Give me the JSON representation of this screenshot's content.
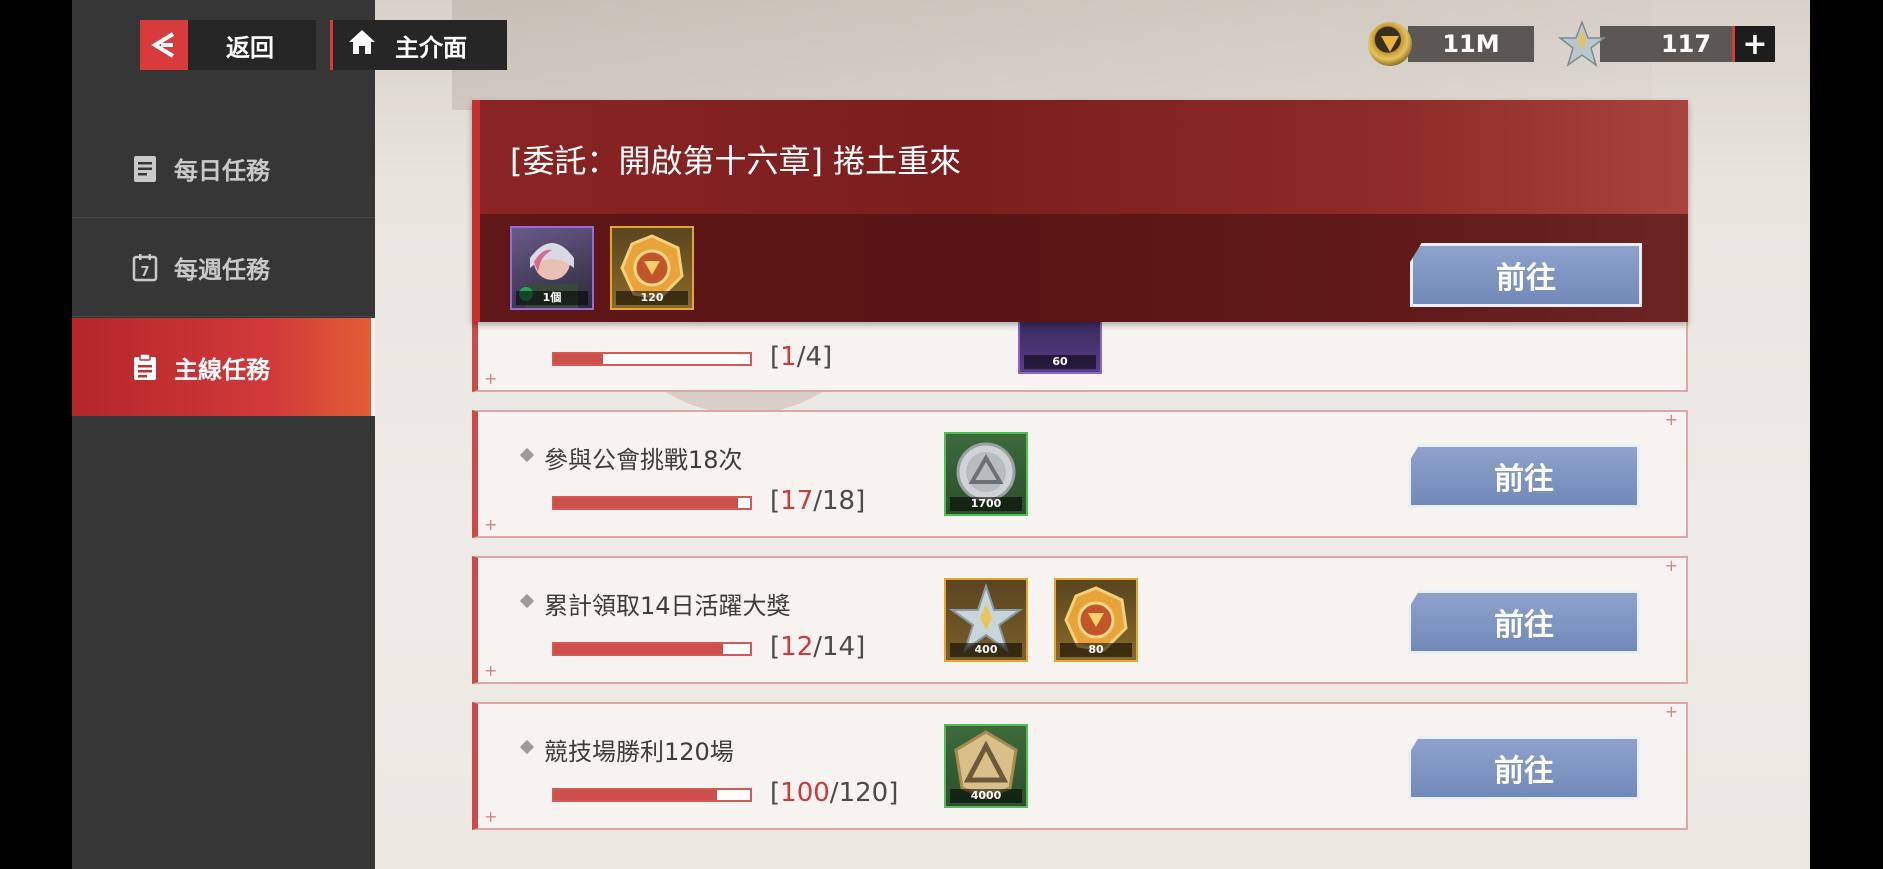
{
  "nav": {
    "back_label": "返回",
    "home_label": "主介面"
  },
  "currency": {
    "gold": "11M",
    "stars": "117",
    "plus": "+"
  },
  "sidebar": {
    "items": [
      {
        "label": "每日任務",
        "icon": "document-icon",
        "active": false
      },
      {
        "label": "每週任務",
        "icon": "calendar-icon",
        "active": false
      },
      {
        "label": "主線任務",
        "icon": "clipboard-icon",
        "active": true
      }
    ]
  },
  "featured": {
    "title": "[委託：開啟第十六章] 捲土重來",
    "rewards": [
      {
        "icon": "character-portrait-icon",
        "count": "1個"
      },
      {
        "icon": "gold-medal-icon",
        "count": "120"
      }
    ],
    "button": "前往"
  },
  "partial_row": {
    "progress_current": "1",
    "progress_total": "4",
    "reward_count": "60"
  },
  "missions": [
    {
      "name": "參與公會挑戰18次",
      "current": "17",
      "total": "18",
      "ratio": 0.944,
      "rewards": [
        {
          "icon": "silver-coin-icon",
          "count": "1700"
        }
      ],
      "button": "前往"
    },
    {
      "name": "累計領取14日活躍大獎",
      "current": "12",
      "total": "14",
      "ratio": 0.857,
      "rewards": [
        {
          "icon": "crystal-star-icon",
          "count": "400"
        },
        {
          "icon": "gold-medal-icon",
          "count": "80"
        }
      ],
      "button": "前往"
    },
    {
      "name": "競技場勝利120場",
      "current": "100",
      "total": "120",
      "ratio": 0.833,
      "rewards": [
        {
          "icon": "arena-emblem-icon",
          "count": "4000"
        }
      ],
      "button": "前往"
    }
  ],
  "colors": {
    "accent_red": "#cc3a3a",
    "button_blue": "#7a8fc0",
    "sidebar_bg": "#363636"
  }
}
